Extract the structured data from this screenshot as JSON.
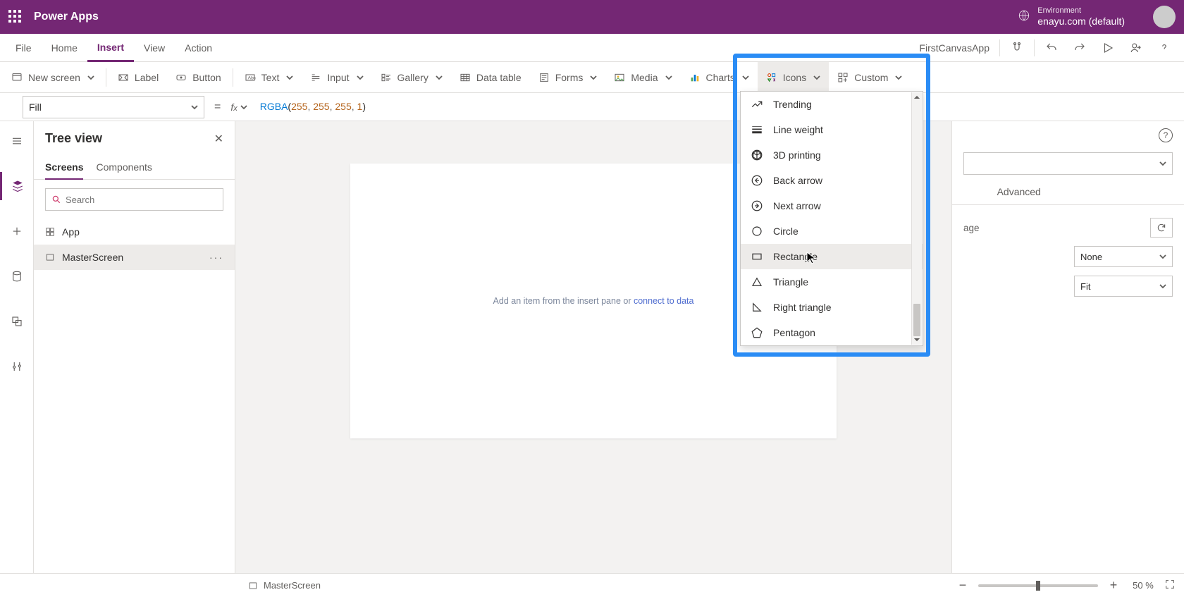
{
  "header": {
    "brand": "Power Apps",
    "env_label": "Environment",
    "env_name": "enayu.com (default)"
  },
  "menu": {
    "items": [
      "File",
      "Home",
      "Insert",
      "View",
      "Action"
    ],
    "active": "Insert",
    "app_name": "FirstCanvasApp"
  },
  "ribbon": {
    "new_screen": "New screen",
    "label": "Label",
    "button": "Button",
    "text": "Text",
    "input": "Input",
    "gallery": "Gallery",
    "data_table": "Data table",
    "forms": "Forms",
    "media": "Media",
    "charts": "Charts",
    "icons": "Icons",
    "custom": "Custom"
  },
  "formula": {
    "property": "Fill",
    "fn": "RGBA",
    "args": [
      "255",
      "255",
      "255",
      "1"
    ]
  },
  "tree": {
    "title": "Tree view",
    "tabs": {
      "screens": "Screens",
      "components": "Components"
    },
    "search_placeholder": "Search",
    "items": {
      "app": "App",
      "master": "MasterScreen"
    }
  },
  "canvas": {
    "hint_prefix": "Add an item from the insert pane",
    "hint_middle": " or ",
    "hint_link": "connect to data"
  },
  "icons_dropdown": {
    "items": [
      "Trending",
      "Line weight",
      "3D printing",
      "Back arrow",
      "Next arrow",
      "Circle",
      "Rectangle",
      "Triangle",
      "Right triangle",
      "Pentagon"
    ],
    "hovered": "Rectangle"
  },
  "properties": {
    "tab_advanced": "Advanced",
    "row_image_label": "age",
    "row_image_value": "None",
    "row_fit_value": "Fit"
  },
  "status": {
    "screen_name": "MasterScreen",
    "zoom": "50",
    "zoom_suffix": "%"
  }
}
